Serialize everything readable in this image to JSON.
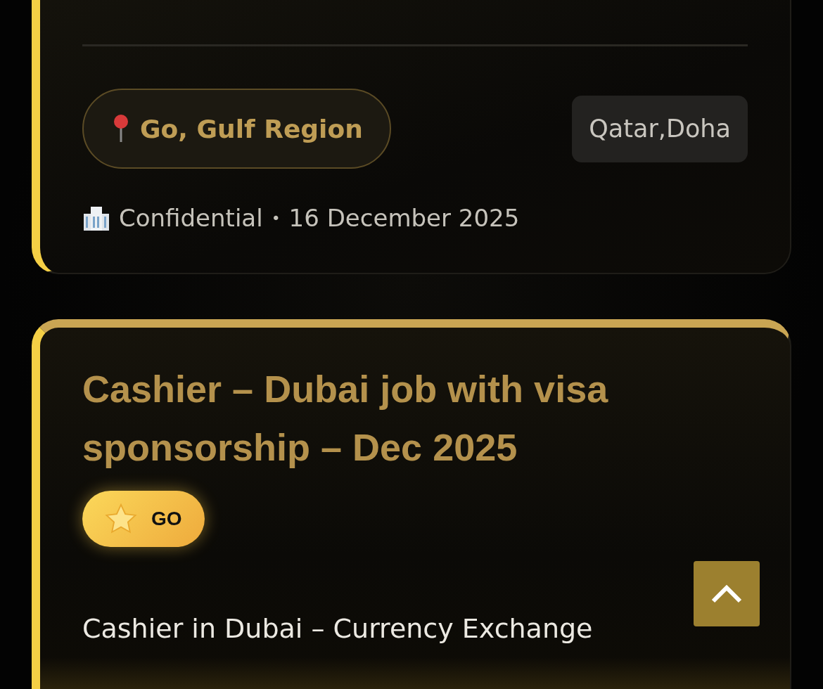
{
  "previous_job": {
    "location": "Go, Gulf Region",
    "tag": "Qatar,Doha",
    "company": "Confidential",
    "separator": "•",
    "date": "16 December 2025"
  },
  "job": {
    "title": "Cashier – Dubai job with visa sponsorship – Dec 2025",
    "badge": "GO",
    "description": "Cashier in Dubai – Currency Exchange"
  }
}
